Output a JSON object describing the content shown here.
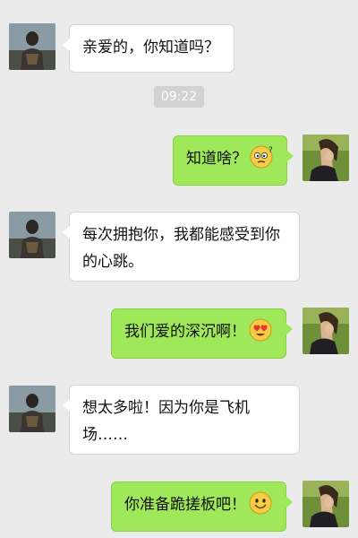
{
  "conversation": {
    "time": "09:22",
    "messages": [
      {
        "side": "received",
        "text": "亲爱的，你知道吗？"
      },
      {
        "side": "sent",
        "text": "知道啥？",
        "emoji": "confused-face-icon"
      },
      {
        "side": "received",
        "line1": "每次拥抱你，我都能感受到你",
        "line2": "的心跳。"
      },
      {
        "side": "sent",
        "text": "我们爱的深沉啊！",
        "emoji": "heart-eyes-face-icon"
      },
      {
        "side": "received",
        "line1": "想太多啦！因为你是飞机",
        "line2": "场……"
      },
      {
        "side": "sent",
        "text": "你准备跪搓板吧！",
        "emoji": "smiling-face-icon"
      }
    ]
  },
  "colors": {
    "background": "#ebebeb",
    "sent_bubble": "#9ee85a",
    "received_bubble": "#ffffff"
  }
}
